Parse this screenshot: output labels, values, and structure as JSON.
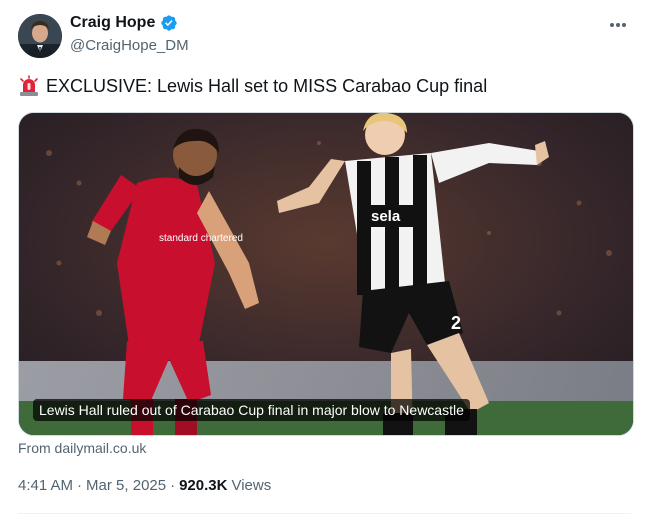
{
  "author": {
    "display_name": "Craig Hope",
    "handle": "@CraigHope_DM",
    "verified": true,
    "avatar_icon": "avatar-icon"
  },
  "more_icon": "more-dots-icon",
  "tweet": {
    "emoji_icon": "siren-icon",
    "text": "EXCLUSIVE: Lewis Hall set to MISS Carabao Cup final"
  },
  "card": {
    "caption": "Lewis Hall ruled out of Carabao Cup final in major blow to Newcastle",
    "source": "From dailymail.co.uk",
    "shirt_left_number": "",
    "shirt_right_sponsor": "sela",
    "shirt_left_sponsor": "standard chartered",
    "shirt_right_number": "2"
  },
  "meta": {
    "time": "4:41 AM",
    "separator": "·",
    "date": "Mar 5, 2025",
    "views_count": "920.3K",
    "views_label": "Views"
  },
  "colors": {
    "verified_blue": "#1d9bf0",
    "secondary_text": "#536471",
    "liverpool_red": "#c8102e",
    "border": "#cfd9de"
  }
}
